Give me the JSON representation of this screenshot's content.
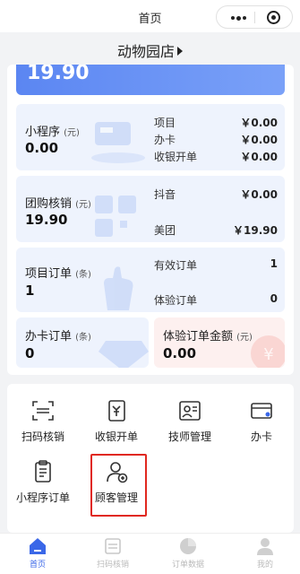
{
  "nav": {
    "title": "首页"
  },
  "store": {
    "name": "动物园店"
  },
  "hero": {
    "amount": "19.90"
  },
  "mini_program": {
    "title": "小程序",
    "unit": "(元)",
    "value": "0.00",
    "rows": [
      {
        "label": "项目",
        "value": "￥0.00"
      },
      {
        "label": "办卡",
        "value": "￥0.00"
      },
      {
        "label": "收银开单",
        "value": "￥0.00"
      }
    ]
  },
  "group_buy": {
    "title": "团购核销",
    "unit": "(元)",
    "value": "19.90",
    "rows": [
      {
        "label": "抖音",
        "value": "￥0.00"
      },
      {
        "label": "美团",
        "value": "￥19.90"
      }
    ]
  },
  "project_orders": {
    "title": "项目订单",
    "unit": "(条)",
    "value": "1",
    "rows": [
      {
        "label": "有效订单",
        "value": "1"
      },
      {
        "label": "体验订单",
        "value": "0"
      }
    ]
  },
  "card_orders": {
    "title": "办卡订单",
    "unit": "(条)",
    "value": "0"
  },
  "trial_amount": {
    "title": "体验订单金额",
    "unit": "(元)",
    "value": "0.00"
  },
  "grid": [
    {
      "label": "扫码核销",
      "icon": "scan-icon"
    },
    {
      "label": "收银开单",
      "icon": "cashier-icon"
    },
    {
      "label": "技师管理",
      "icon": "technician-icon"
    },
    {
      "label": "办卡",
      "icon": "card-icon"
    },
    {
      "label": "小程序订单",
      "icon": "clipboard-icon"
    },
    {
      "label": "顾客管理",
      "icon": "customer-add-icon"
    }
  ],
  "tabs": [
    {
      "label": "首页",
      "icon": "home-icon",
      "active": true
    },
    {
      "label": "扫码核销",
      "icon": "scan-icon",
      "active": false
    },
    {
      "label": "订单数据",
      "icon": "pie-chart-icon",
      "active": false
    },
    {
      "label": "我的",
      "icon": "person-icon",
      "active": false
    }
  ],
  "colors": {
    "accent": "#3a67e8",
    "highlight": "#e0281f",
    "card_blue": "#eef3fd",
    "card_pink": "#fdf0ef"
  }
}
